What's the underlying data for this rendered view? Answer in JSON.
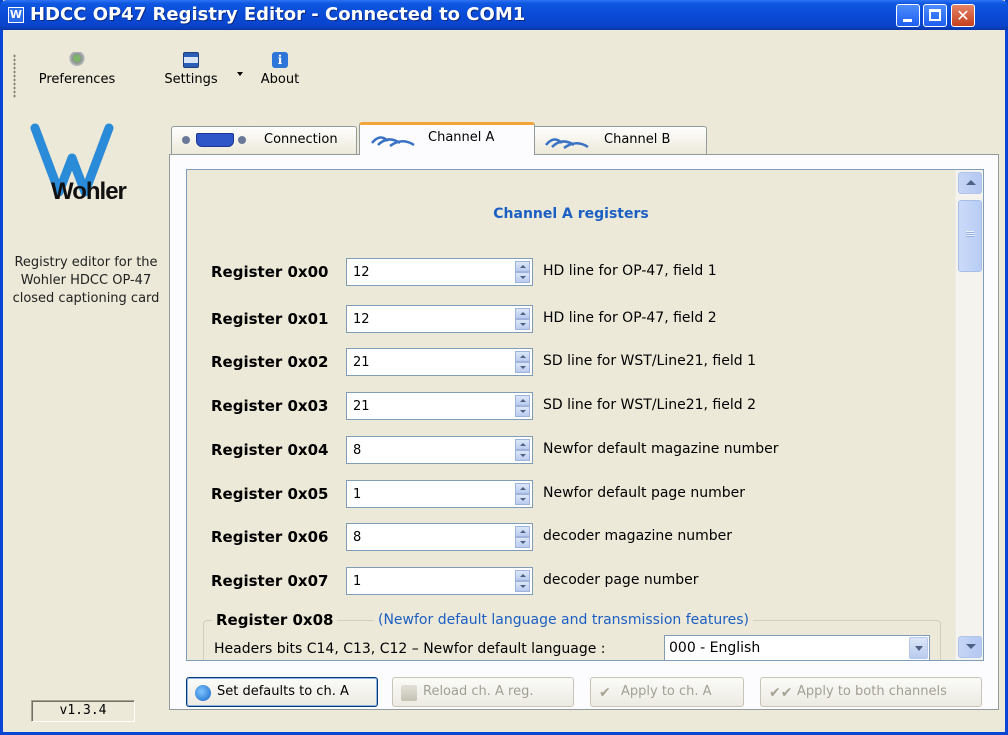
{
  "window": {
    "title": "HDCC OP47 Registry Editor - Connected to COM1",
    "app_icon": "W"
  },
  "toolbar": {
    "preferences": "Preferences",
    "settings": "Settings",
    "about": "About"
  },
  "sidebar": {
    "logo_text": "Wohler",
    "description": "Registry editor for the Wohler HDCC OP-47 closed captioning card",
    "version": "v1.3.4"
  },
  "tabs": [
    {
      "label": "Connection"
    },
    {
      "label": "Channel A"
    },
    {
      "label": "Channel B"
    }
  ],
  "panel": {
    "title": "Channel A registers",
    "registers": [
      {
        "label": "Register 0x00",
        "value": "12",
        "desc": "HD line for OP-47, field 1"
      },
      {
        "label": "Register 0x01",
        "value": "12",
        "desc": "HD line for OP-47, field 2"
      },
      {
        "label": "Register 0x02",
        "value": "21",
        "desc": "SD line for WST/Line21, field 1"
      },
      {
        "label": "Register 0x03",
        "value": "21",
        "desc": "SD line for WST/Line21, field 2"
      },
      {
        "label": "Register 0x04",
        "value": "8",
        "desc": "Newfor default magazine number"
      },
      {
        "label": "Register 0x05",
        "value": "1",
        "desc": "Newfor default page number"
      },
      {
        "label": "Register 0x06",
        "value": "8",
        "desc": "decoder magazine number"
      },
      {
        "label": "Register 0x07",
        "value": "1",
        "desc": "decoder page number"
      }
    ],
    "group": {
      "label": "Register 0x08",
      "subtitle": "(Newfor default language and transmission features)",
      "row_label": "Headers bits C14, C13, C12 – Newfor default language :",
      "combo_value": "000 - English"
    }
  },
  "buttons": {
    "defaults": "Set defaults to ch. A",
    "reload": "Reload ch. A reg.",
    "apply": "Apply to ch. A",
    "apply_both": "Apply to both channels"
  }
}
